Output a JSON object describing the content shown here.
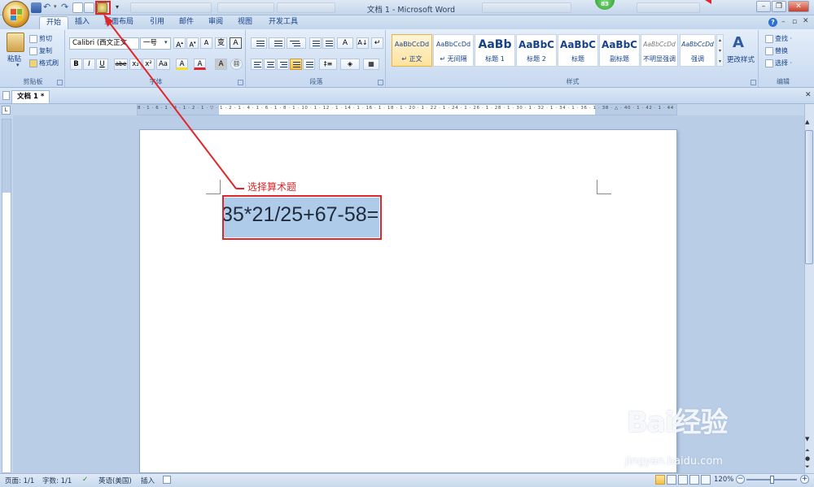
{
  "window": {
    "title": "文档 1 - Microsoft Word",
    "notification_count": "83"
  },
  "qat": {
    "customize_glyph": "▾"
  },
  "tabs": [
    "开始",
    "插入",
    "页面布局",
    "引用",
    "邮件",
    "审阅",
    "视图",
    "开发工具"
  ],
  "clipboard": {
    "paste": "粘贴",
    "cut": "剪切",
    "copy": "复制",
    "format_painter": "格式刷",
    "label": "剪贴板"
  },
  "font": {
    "name": "Calibri (西文正文",
    "size": "一号",
    "label": "字体",
    "buttons": [
      "B",
      "I",
      "U",
      "abe",
      "x₂",
      "x²",
      "Aa",
      "A",
      "A",
      "A"
    ]
  },
  "paragraph": {
    "label": "段落"
  },
  "styles": {
    "label": "样式",
    "change_styles": "更改样式",
    "items": [
      {
        "sample": "AaBbCcDd",
        "name": "↵ 正文"
      },
      {
        "sample": "AaBbCcDd",
        "name": "↵ 无间隔"
      },
      {
        "sample": "AaBb",
        "name": "标题 1"
      },
      {
        "sample": "AaBbC",
        "name": "标题 2"
      },
      {
        "sample": "AaBbC",
        "name": "标题"
      },
      {
        "sample": "AaBbC",
        "name": "副标题"
      },
      {
        "sample": "AaBbCcDd",
        "name": "不明显强调"
      },
      {
        "sample": "AaBbCcDd",
        "name": "强调"
      }
    ]
  },
  "editing": {
    "find": "查找 ·",
    "replace": "替换",
    "select": "选择 ·",
    "label": "编辑"
  },
  "document": {
    "tab": "文档 1 *",
    "equation": "35*21/25+67-58=",
    "equation_selected": "35*21/25+67-58",
    "equals": "="
  },
  "ruler": {
    "ticks": "8 · 1 · 6 · 1 · 4 · 1 · 2 · 1 · ▽ · 1 · 2 · 1 · 4 · 1 · 6 · 1 · 8 · 1 · 10 · 1 · 12 · 1 · 14 · 1 · 16 · 1 · 18 · 1 · 20 · 1 · 22 · 1 · 24 · 1 · 26 · 1 · 28 · 1 · 30 · 1 · 32 · 1 · 34 · 1 · 36 · 1 · 38 · △ · 40 · 1 · 42 · 1 · 44 · 1 · 46 · 1 · 48"
  },
  "annotation": {
    "text": "选择算术题",
    "color": "#e0262a"
  },
  "status": {
    "page": "页面: 1/1",
    "words": "字数: 1/1",
    "language": "英语(美国)",
    "mode": "插入",
    "zoom": "120%"
  },
  "watermark": {
    "brand": "Bai经验",
    "url": "jingyan.baidu.com"
  },
  "colors": {
    "ribbon": "#d4e2f4",
    "accent_red": "#e0262a",
    "selection": "#aecbe9"
  }
}
